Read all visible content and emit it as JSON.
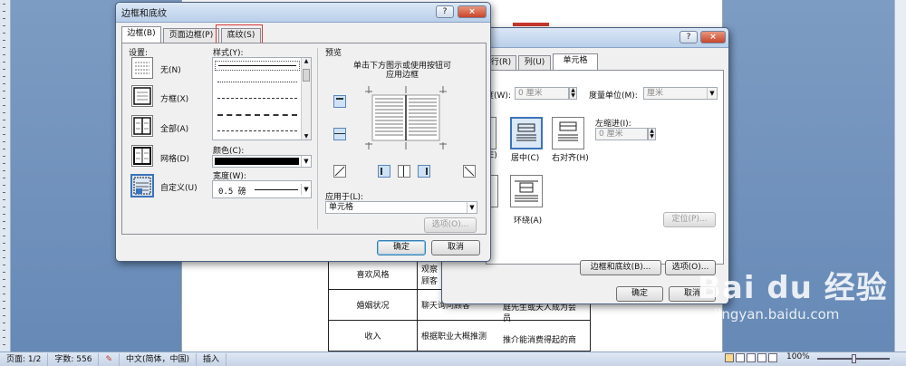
{
  "background_doc": {
    "table_rows": [
      {
        "label": "喜欢风格",
        "value": "观察\n顾客",
        "extra": ""
      },
      {
        "label": "婚姻状况",
        "value": "聊天询问顾客",
        "extra": "庭先生或夫人成为会\n员"
      },
      {
        "label": "收入",
        "value": "根据职业大概推测",
        "extra": "推介能消费得起的商"
      }
    ]
  },
  "status_bar": {
    "page": "页面: 1/2",
    "words": "字数: 556",
    "language": "中文(简体，中国)",
    "mode": "插入",
    "zoom": "100%"
  },
  "table_props": {
    "help": "?",
    "close": "×",
    "tabs": [
      "行(R)",
      "列(U)",
      "单元格"
    ],
    "width_label": "度(W):",
    "width_value": "0 厘米",
    "unit_label": "度量单位(M):",
    "unit_value": "厘米",
    "left_indent_label": "左缩进(I):",
    "left_indent_value": "0 厘米",
    "align_center": "居中(C)",
    "align_right": "右对齐(H)",
    "wrap_around": "环绕(A)",
    "position_btn": "定位(P)...",
    "borders_btn": "边框和底纹(B)...",
    "options_btn": "选项(O)...",
    "ok": "确定",
    "cancel": "取消",
    "left_partial": "(E)"
  },
  "borders_dialog": {
    "title": "边框和底纹",
    "help": "?",
    "close": "×",
    "tabs": [
      "边框(B)",
      "页面边框(P)",
      "底纹(S)"
    ],
    "highlight_color": "#d9393b",
    "settings_label": "设置:",
    "settings": [
      "无(N)",
      "方框(X)",
      "全部(A)",
      "网格(D)",
      "自定义(U)"
    ],
    "style_label": "样式(Y):",
    "color_label": "颜色(C):",
    "color_value": "#000000",
    "width_label": "宽度(W):",
    "width_value": "0.5 磅",
    "preview_label": "预览",
    "preview_hint_line1": "单击下方图示或使用按钮可",
    "preview_hint_line2": "应用边框",
    "apply_to_label": "应用于(L):",
    "apply_to_value": "单元格",
    "options_btn": "选项(O)...",
    "ok": "确定",
    "cancel": "取消"
  },
  "watermark": {
    "brand": "Bai du 经验",
    "url": "jingyan.baidu.com"
  }
}
